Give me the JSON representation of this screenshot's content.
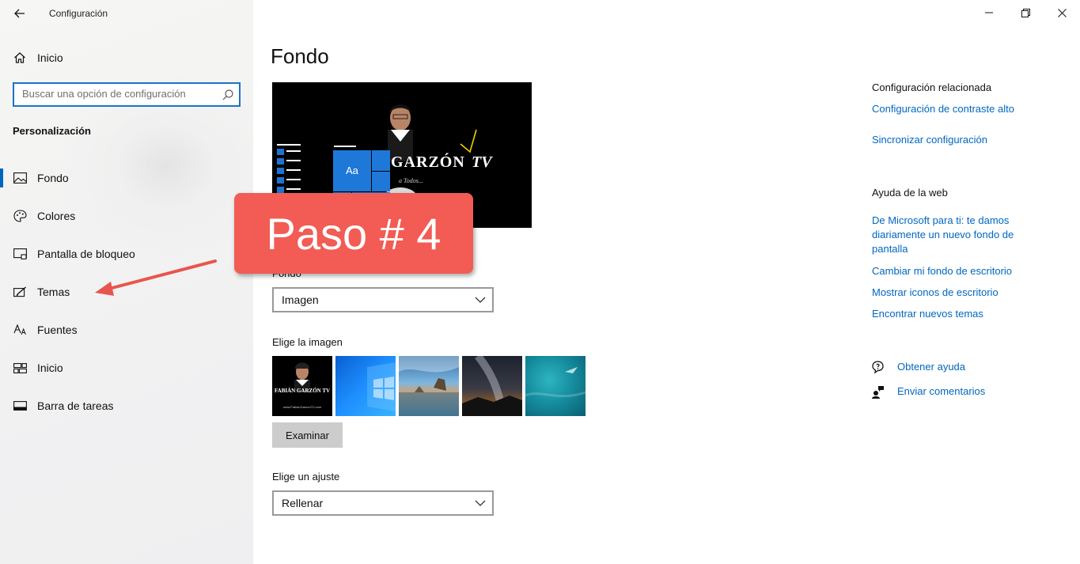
{
  "app": {
    "title": "Configuración"
  },
  "sidebar": {
    "home_label": "Inicio",
    "search_placeholder": "Buscar una opción de configuración",
    "section_title": "Personalización",
    "items": [
      {
        "label": "Fondo",
        "icon": "image-icon",
        "active": true
      },
      {
        "label": "Colores",
        "icon": "palette-icon"
      },
      {
        "label": "Pantalla de bloqueo",
        "icon": "lock-screen-icon"
      },
      {
        "label": "Temas",
        "icon": "brush-icon"
      },
      {
        "label": "Fuentes",
        "icon": "font-icon"
      },
      {
        "label": "Inicio",
        "icon": "start-icon"
      },
      {
        "label": "Barra de tareas",
        "icon": "taskbar-icon"
      }
    ]
  },
  "main": {
    "title": "Fondo",
    "preview": {
      "text_1": "GARZÓN",
      "text_2": "TV",
      "tile_label": "Aa",
      "tagline": "a Todos..."
    },
    "background_label": "Fondo",
    "background_value": "Imagen",
    "choose_image_label": "Elige la imagen",
    "thumb_1_text": "FABIÁN GARZÓN TV",
    "thumb_1_sub": "www.FabianGarzonTV.com",
    "browse_label": "Examinar",
    "fit_label": "Elige un ajuste",
    "fit_value": "Rellenar"
  },
  "related": {
    "heading": "Configuración relacionada",
    "links": [
      "Configuración de contraste alto",
      "Sincronizar configuración"
    ]
  },
  "help": {
    "heading": "Ayuda de la web",
    "links": [
      "De Microsoft para ti: te damos diariamente un nuevo fondo de pantalla",
      "Cambiar mi fondo de escritorio",
      "Mostrar iconos de escritorio",
      "Encontrar nuevos temas"
    ],
    "get_help": "Obtener ayuda",
    "feedback": "Enviar comentarios"
  },
  "annotation": {
    "text": "Paso # 4"
  },
  "colors": {
    "accent": "#0067c0",
    "callout": "#f25c54"
  }
}
